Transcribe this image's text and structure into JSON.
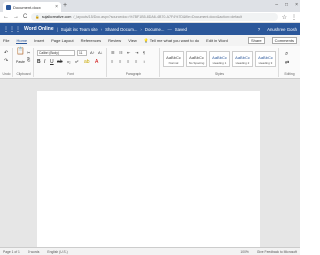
{
  "browser": {
    "tab_title": "Document.docx",
    "tab_close": "×",
    "new_tab": "+",
    "window_controls": [
      "–",
      "□",
      "×"
    ],
    "url_domain": "sujalkcreative.com",
    "url_rest": "/_layouts/15/Doc.aspx?sourcedoc=%7BF1B5-8DA6-4B70-A7F4%7D&file=Document.docx&action=default",
    "back": "←",
    "forward": "→",
    "reload": "C",
    "star": "☆",
    "menu": "⋮"
  },
  "titlebar": {
    "app_name": "Word Online",
    "breadcrumb1": "Sujalt inc Team site",
    "breadcrumb2": "Shared Docum...",
    "breadcrumb3": "Docume...",
    "saved": "Saved",
    "user": "Anushree Gosh"
  },
  "tabs": [
    "File",
    "Home",
    "Insert",
    "Page Layout",
    "References",
    "Review",
    "View"
  ],
  "tabs_active": "Home",
  "tell_me": "Tell me what you want to do",
  "edit_in_word": "Edit in Word",
  "share": "Share",
  "comments": "Comments",
  "ribbon": {
    "undo_label": "Undo",
    "clipboard_label": "Clipboard",
    "paste_label": "Paste",
    "font_label": "Font",
    "font_name": "Calibri (Body)",
    "font_size": "11",
    "paragraph_label": "Paragraph",
    "styles_label": "Styles",
    "editing_label": "Editing",
    "styles": [
      {
        "preview": "AaBbCc",
        "name": "Normal"
      },
      {
        "preview": "AaBbCc",
        "name": "No Spacing"
      },
      {
        "preview": "AaBbCc",
        "name": "Heading 1"
      },
      {
        "preview": "AaBbCc",
        "name": "Heading 2"
      },
      {
        "preview": "AaBbCc",
        "name": "Heading 3"
      }
    ]
  },
  "statusbar": {
    "page": "Page 1 of 1",
    "words": "0 words",
    "language": "English (U.S.)",
    "zoom": "100%",
    "feedback": "Give Feedback to Microsoft"
  }
}
